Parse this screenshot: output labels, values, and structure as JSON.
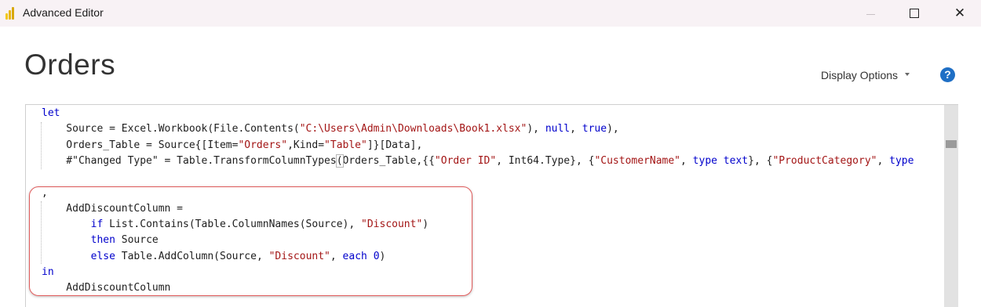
{
  "window": {
    "title": "Advanced Editor",
    "close_glyph": "✕"
  },
  "header": {
    "query_name": "Orders",
    "display_options_label": "Display Options",
    "help_glyph": "?"
  },
  "colors": {
    "keyword": "#0000cc",
    "string": "#a31515",
    "highlight_border": "#e05a5a",
    "help_icon": "#1f6fc5"
  },
  "code": {
    "lines": [
      [
        {
          "t": "let",
          "c": "kw"
        }
      ],
      [
        {
          "t": "    Source = Excel.Workbook(File.Contents("
        },
        {
          "t": "\"C:\\Users\\Admin\\Downloads\\Book1.xlsx\"",
          "c": "str"
        },
        {
          "t": "), "
        },
        {
          "t": "null",
          "c": "kw"
        },
        {
          "t": ", "
        },
        {
          "t": "true",
          "c": "kw"
        },
        {
          "t": "),"
        }
      ],
      [
        {
          "t": "    Orders_Table = Source{[Item="
        },
        {
          "t": "\"Orders\"",
          "c": "str"
        },
        {
          "t": ",Kind="
        },
        {
          "t": "\"Table\"",
          "c": "str"
        },
        {
          "t": "]}[Data],"
        }
      ],
      [
        {
          "t": "    #\"Changed Type\" = Table.TransformColumnTypes"
        },
        {
          "t": "(",
          "c": "paren"
        },
        {
          "t": "Orders_Table,{{"
        },
        {
          "t": "\"Order ID\"",
          "c": "str"
        },
        {
          "t": ", Int64.Type}, {"
        },
        {
          "t": "\"CustomerName\"",
          "c": "str"
        },
        {
          "t": ", "
        },
        {
          "t": "type text",
          "c": "kw"
        },
        {
          "t": "}, {"
        },
        {
          "t": "\"ProductCategory\"",
          "c": "str"
        },
        {
          "t": ", "
        },
        {
          "t": "type",
          "c": "kw"
        }
      ],
      [],
      [
        {
          "t": ","
        }
      ],
      [
        {
          "t": "    AddDiscountColumn ="
        }
      ],
      [
        {
          "t": "        "
        },
        {
          "t": "if",
          "c": "kw"
        },
        {
          "t": " List.Contains(Table.ColumnNames(Source), "
        },
        {
          "t": "\"Discount\"",
          "c": "str"
        },
        {
          "t": ")"
        }
      ],
      [
        {
          "t": "        "
        },
        {
          "t": "then",
          "c": "kw"
        },
        {
          "t": " Source"
        }
      ],
      [
        {
          "t": "        "
        },
        {
          "t": "else",
          "c": "kw"
        },
        {
          "t": " Table.AddColumn(Source, "
        },
        {
          "t": "\"Discount\"",
          "c": "str"
        },
        {
          "t": ", "
        },
        {
          "t": "each",
          "c": "kw"
        },
        {
          "t": " "
        },
        {
          "t": "0",
          "c": "kw"
        },
        {
          "t": ")"
        }
      ],
      [
        {
          "t": "in",
          "c": "kw"
        }
      ],
      [
        {
          "t": "    AddDiscountColumn"
        }
      ]
    ]
  }
}
